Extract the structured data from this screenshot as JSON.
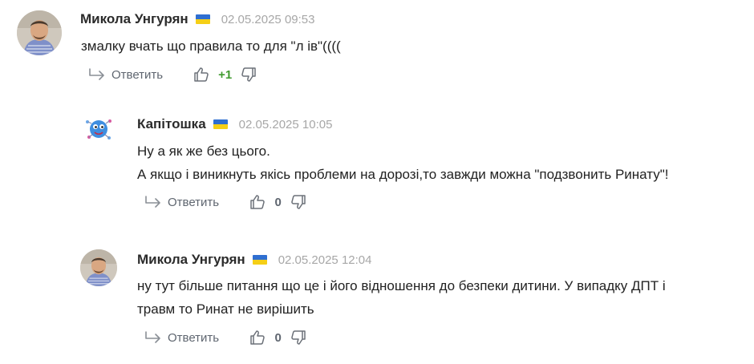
{
  "comments": [
    {
      "author": "Микола Унгурян",
      "time": "02.05.2025 09:53",
      "text_lines": [
        "змалку вчать що правила то для \"л      ів\"(((("
      ],
      "reply_label": "Ответить",
      "score": "+1",
      "avatar_icon": "man-photo-avatar"
    },
    {
      "author": "Капітошка",
      "time": "02.05.2025 10:05",
      "text_lines": [
        "Ну а як же без цього.",
        "А якщо і виникнуть якісь проблеми на дорозі,то завжди можна \"подзвонить Ринату\"!"
      ],
      "reply_label": "Ответить",
      "score": "0",
      "avatar_icon": "kapitoshka-cartoon-avatar"
    },
    {
      "author": "Микола Унгурян",
      "time": "02.05.2025 12:04",
      "text_lines": [
        "ну тут більше питання що це і його відношення до безпеки дитини. У випадку ДПТ  і",
        "травм то Ринат не вирішить"
      ],
      "reply_label": "Ответить",
      "score": "0",
      "avatar_icon": "man-photo-avatar"
    }
  ],
  "colors": {
    "flag_blue": "#2f6fd1",
    "flag_yellow": "#f5cf17",
    "positive_score": "#3f9a2e",
    "muted": "#a7a7a7"
  }
}
